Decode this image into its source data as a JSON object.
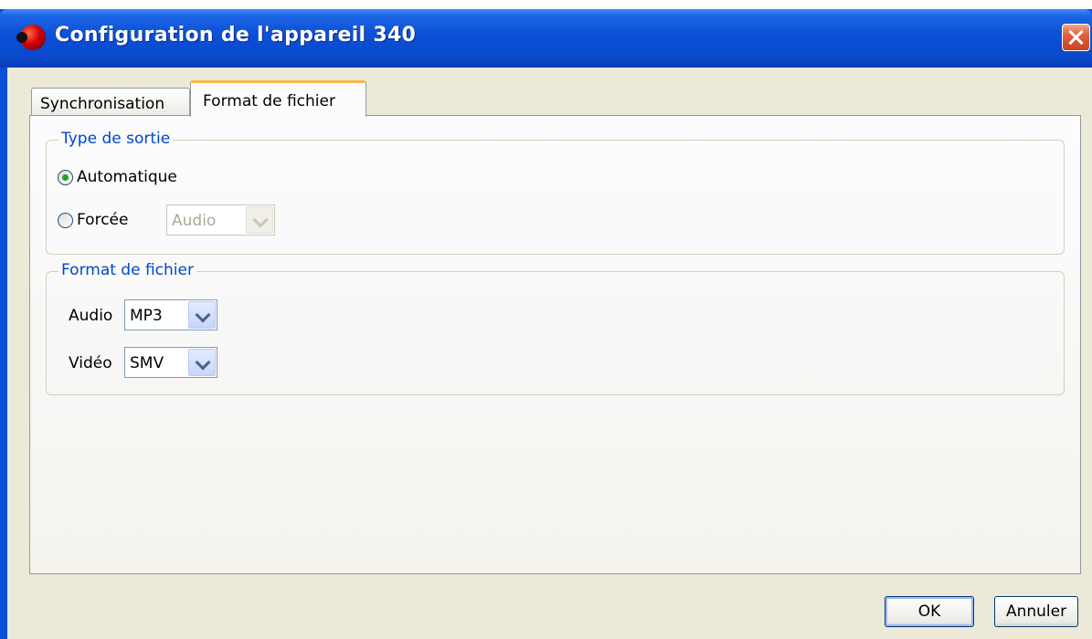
{
  "window": {
    "title": "Configuration de l'appareil 340",
    "app_icon": "record-icon",
    "close_icon": "close-icon"
  },
  "tabs": [
    {
      "label": "Synchronisation",
      "active": false
    },
    {
      "label": "Format de fichier",
      "active": true
    }
  ],
  "output_type": {
    "legend": "Type de sortie",
    "options": [
      {
        "label": "Automatique",
        "checked": true
      },
      {
        "label": "Forcée",
        "checked": false
      }
    ],
    "forced_select": {
      "value": "Audio",
      "enabled": false
    }
  },
  "file_format": {
    "legend": "Format de fichier",
    "audio": {
      "label": "Audio",
      "value": "MP3"
    },
    "video": {
      "label": "Vidéo",
      "value": "SMV"
    }
  },
  "buttons": {
    "ok": "OK",
    "cancel": "Annuler"
  },
  "colors": {
    "titlebar": "#0a4fd8",
    "accent_tab": "#f7b64c",
    "legend_text": "#0046d5",
    "dialog_bg": "#ece9d8"
  }
}
